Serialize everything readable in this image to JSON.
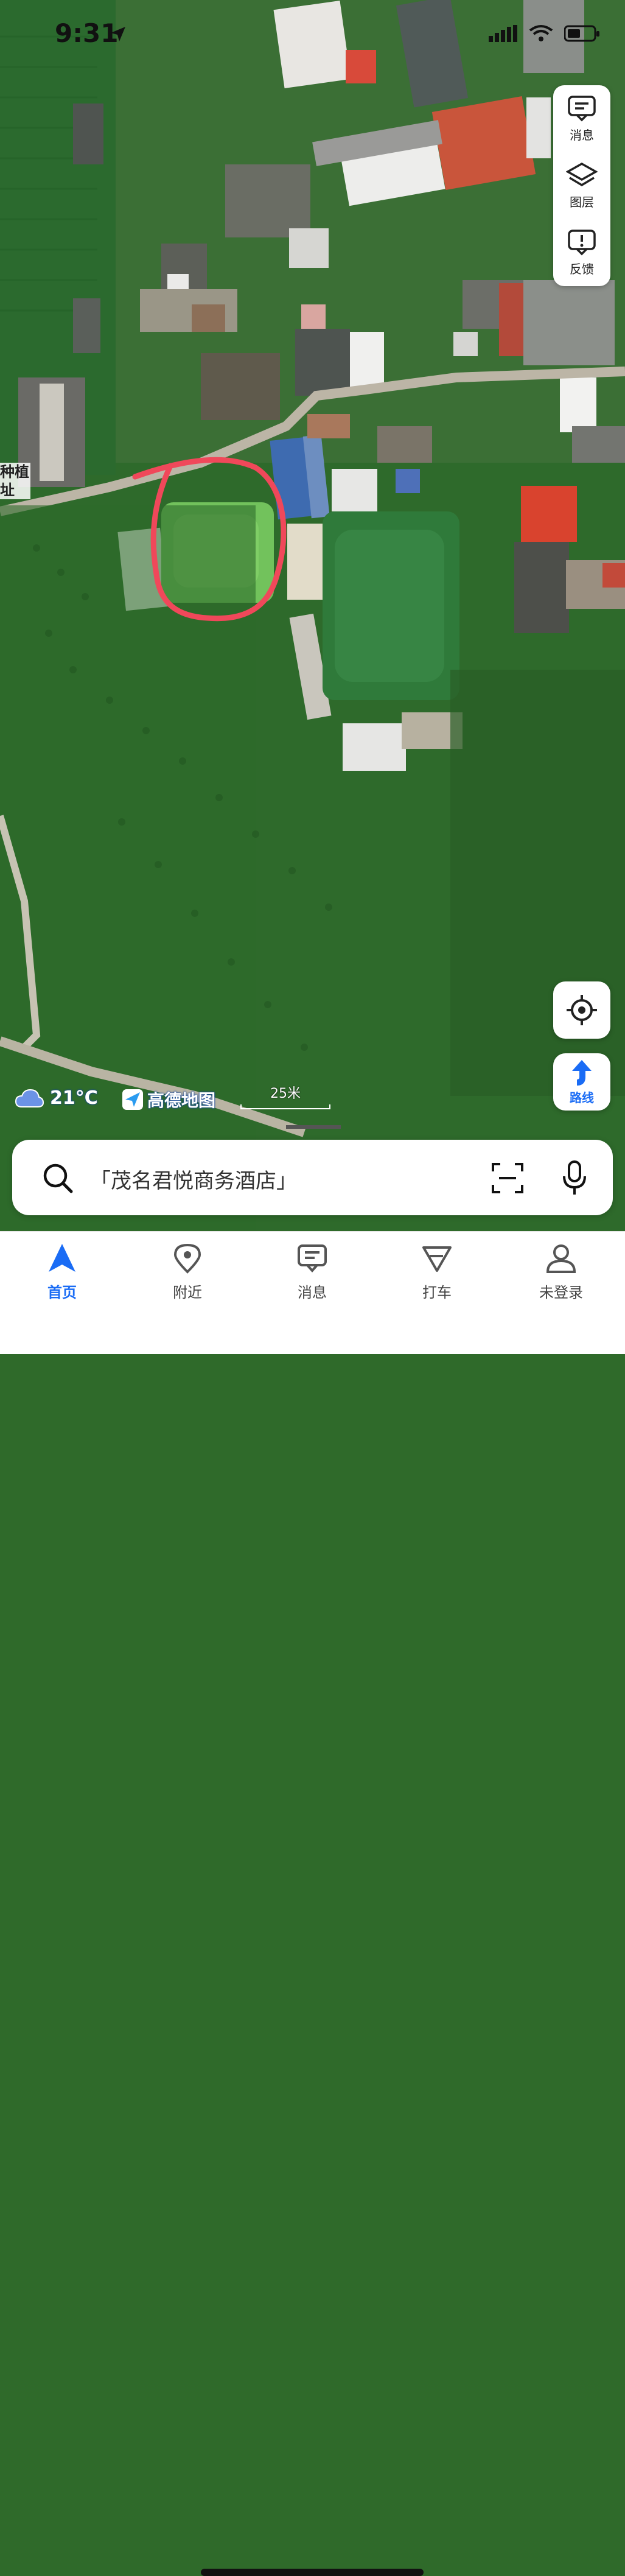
{
  "status_bar": {
    "time": "9:31"
  },
  "map": {
    "side_panel": [
      {
        "label": "消息",
        "icon": "message-icon"
      },
      {
        "label": "图层",
        "icon": "layers-icon"
      },
      {
        "label": "反馈",
        "icon": "feedback-icon"
      }
    ],
    "edge_label": "种植\n址",
    "route_label": "路线",
    "weather": {
      "temp": "21°C",
      "icon": "cloud-icon"
    },
    "brand": "高德地图",
    "scale": "25米"
  },
  "search": {
    "placeholder": "「茂名君悦商务酒店」"
  },
  "tabs": [
    {
      "label": "首页",
      "icon": "home-nav-icon",
      "active": true
    },
    {
      "label": "附近",
      "icon": "location-pin-icon",
      "active": false
    },
    {
      "label": "消息",
      "icon": "message-icon",
      "active": false
    },
    {
      "label": "打车",
      "icon": "taxi-icon",
      "active": false
    },
    {
      "label": "未登录",
      "icon": "user-icon",
      "active": false
    }
  ],
  "colors": {
    "accent": "#1a6cf5",
    "annotation": "#f0485a"
  }
}
